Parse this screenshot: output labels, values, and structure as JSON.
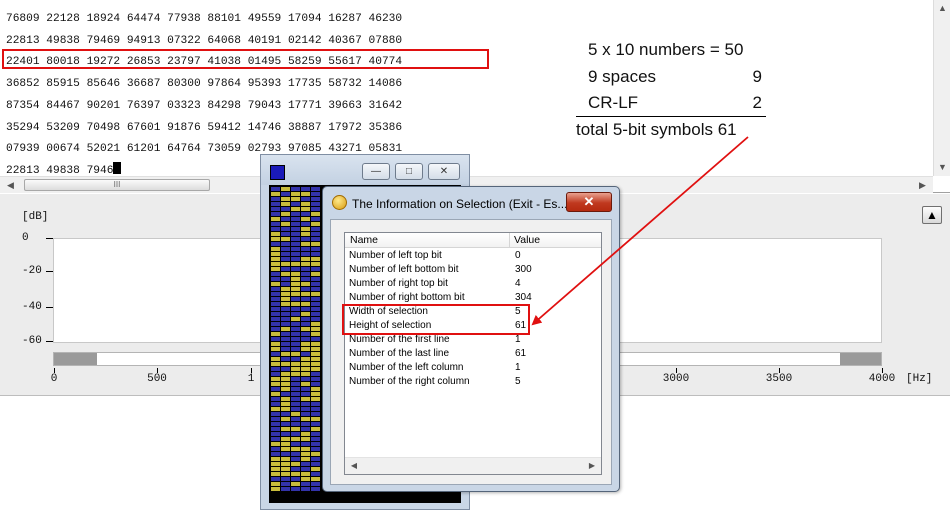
{
  "editor": {
    "lines": [
      "76809 22128 18924 64474 77938 88101 49559 17094 16287 46230",
      "22813 49838 79469 94913 07322 64068 40191 02142 40367 07880",
      "22401 80018 19272 26853 23797 41038 01495 58259 55617 40774",
      "36852 85915 85646 36687 80300 97864 95393 17735 58732 14086",
      "87354 84467 90201 76397 03323 84298 79043 17771 39663 31642",
      "35294 53209 70498 67601 91876 59412 14746 38887 17972 35386",
      "07939 00674 52021 61201 64764 73059 02793 97085 43271 05831"
    ],
    "last_line": "22813 49838 7946",
    "scroll_thumb_glyph": "III"
  },
  "annotation": {
    "line1": "5 x 10 numbers = 50",
    "line2_label": "9 spaces",
    "line2_value": "9",
    "line3_label": "CR-LF",
    "line3_value": "2",
    "line4": "total 5-bit symbols 61",
    "highlight_color": "#e01010"
  },
  "spectrum": {
    "y_unit": "[dB]",
    "y_ticks": [
      "0",
      "-20",
      "-40",
      "-60"
    ],
    "x_ticks": [
      "0",
      "500",
      "1",
      "3000",
      "3500",
      "4000"
    ],
    "x_unit": "[Hz]",
    "up_button_glyph": "▲"
  },
  "bit_window": {
    "min_glyph": "—",
    "max_glyph": "□",
    "close_glyph": "✕",
    "colors": {
      "one": "#c8bc3c",
      "zero": "#3333aa",
      "background": "#000000"
    }
  },
  "dialog": {
    "title": "The Information on Selection (Exit - Es...",
    "close_glyph": "✕",
    "columns": [
      "Name",
      "Value"
    ],
    "rows": [
      {
        "name": "Number of left top bit",
        "value": "0"
      },
      {
        "name": "Number of left bottom bit",
        "value": "300"
      },
      {
        "name": "Number of right top bit",
        "value": "4"
      },
      {
        "name": "Number of right bottom bit",
        "value": "304"
      },
      {
        "name": "Width of selection",
        "value": "5"
      },
      {
        "name": "Height of selection",
        "value": "61"
      },
      {
        "name": "Number of the first line",
        "value": "1"
      },
      {
        "name": "Number of the last line",
        "value": "61"
      },
      {
        "name": "Number of the left column",
        "value": "1"
      },
      {
        "name": "Number of the right column",
        "value": "5"
      }
    ]
  }
}
